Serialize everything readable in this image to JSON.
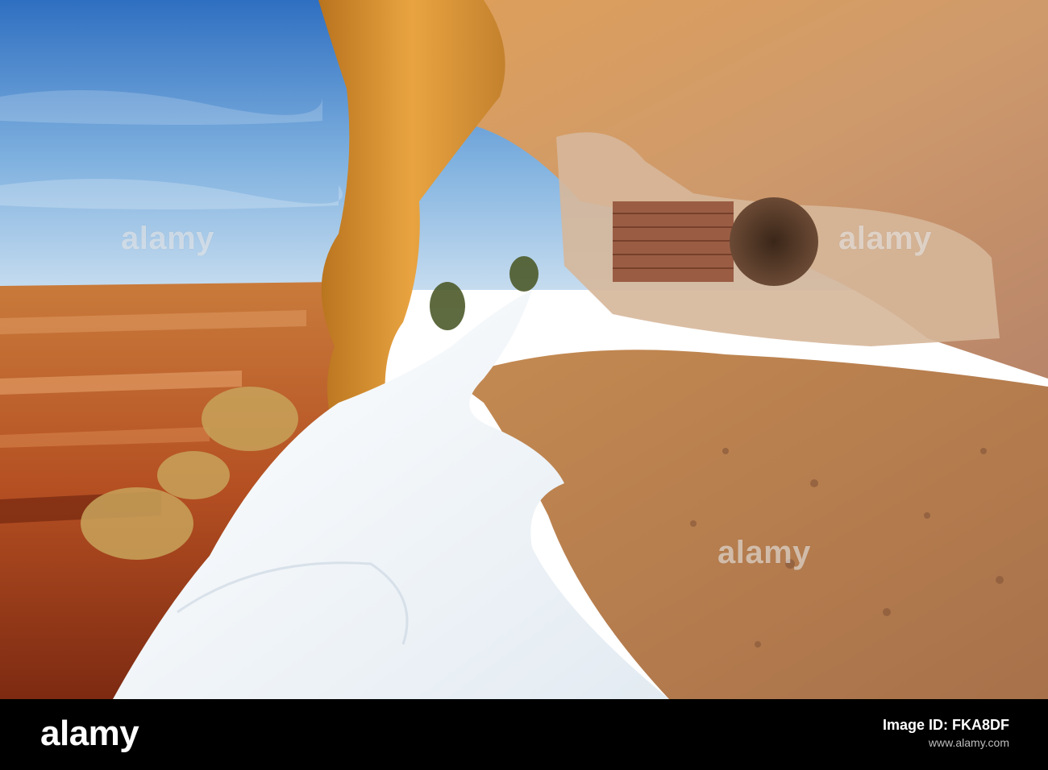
{
  "watermark": {
    "text": "alamy"
  },
  "footer": {
    "logo": "alamy",
    "image_id_label": "Image ID: FKA8DF",
    "site": "www.alamy.com"
  },
  "colors": {
    "sky": "#3d7cc9",
    "rock": "#d9a35d",
    "snow": "#f2f5f7",
    "footer": "#000000"
  }
}
